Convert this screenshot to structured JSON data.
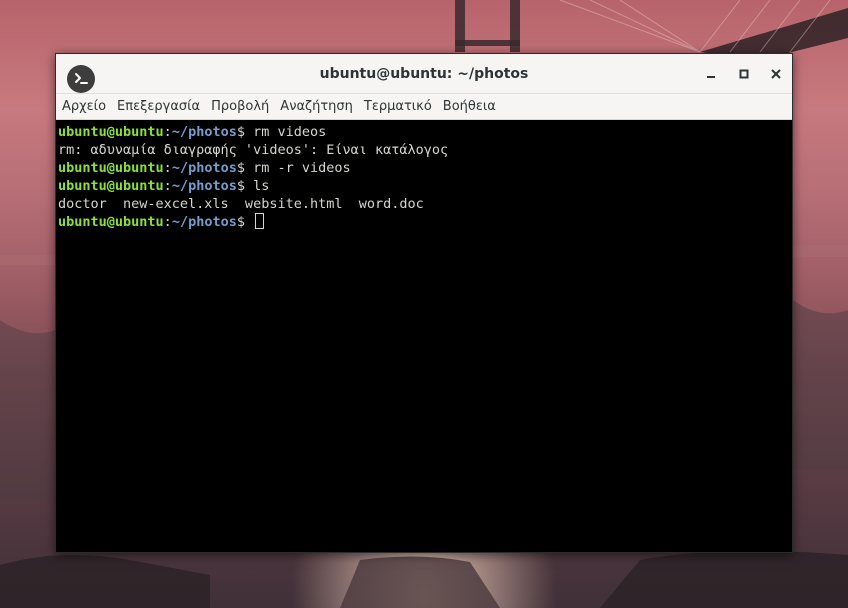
{
  "window": {
    "title": "ubuntu@ubuntu: ~/photos"
  },
  "menu": [
    {
      "label": "Αρχείο"
    },
    {
      "label": "Επεξεργασία"
    },
    {
      "label": "Προβολή"
    },
    {
      "label": "Αναζήτηση"
    },
    {
      "label": "Τερματικό"
    },
    {
      "label": "Βοήθεια"
    }
  ],
  "prompt": {
    "user": "ubuntu@ubuntu",
    "colon": ":",
    "path": "~/photos",
    "symbol": "$ "
  },
  "terminal": {
    "cmd1": "rm videos",
    "error": "rm: αδυναμία διαγραφής 'videos': Είναι κατάλογος",
    "cmd2": "rm -r videos",
    "cmd3": "ls",
    "ls_output": "doctor  new-excel.xls  website.html  word.doc"
  },
  "colors": {
    "user": "#8ae234",
    "path": "#729fcf",
    "text": "#d3d7cf",
    "background": "#000000"
  },
  "icons": {
    "app": "terminal-icon",
    "minimize": "minimize-icon",
    "maximize": "maximize-icon",
    "close": "close-icon"
  }
}
